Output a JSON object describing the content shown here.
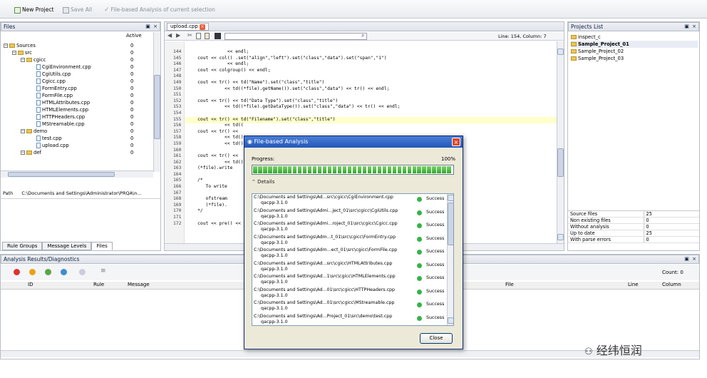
{
  "toolbar": {
    "new_project": "New Project",
    "save_all": "Save All",
    "file_based": "File-based Analysis of current selection"
  },
  "files_panel": {
    "title": "Files",
    "controls": "▣ ×",
    "col_active": "Active",
    "tree": [
      {
        "label": "Sources",
        "value": "0",
        "depth": 0,
        "type": "folder",
        "exp": "−"
      },
      {
        "label": "src",
        "value": "0",
        "depth": 1,
        "type": "folder",
        "exp": "−"
      },
      {
        "label": "cgicc",
        "value": "0",
        "depth": 2,
        "type": "folder",
        "exp": "−"
      },
      {
        "label": "CgiEnvironment.cpp",
        "value": "0",
        "depth": 3,
        "type": "file"
      },
      {
        "label": "CgiUtils.cpp",
        "value": "0",
        "depth": 3,
        "type": "file"
      },
      {
        "label": "Cgicc.cpp",
        "value": "0",
        "depth": 3,
        "type": "file"
      },
      {
        "label": "FormEntry.cpp",
        "value": "0",
        "depth": 3,
        "type": "file"
      },
      {
        "label": "FormFile.cpp",
        "value": "0",
        "depth": 3,
        "type": "file"
      },
      {
        "label": "HTMLAttributes.cpp",
        "value": "0",
        "depth": 3,
        "type": "file"
      },
      {
        "label": "HTMLElements.cpp",
        "value": "0",
        "depth": 3,
        "type": "file"
      },
      {
        "label": "HTTPHeaders.cpp",
        "value": "0",
        "depth": 3,
        "type": "file"
      },
      {
        "label": "MStreamable.cpp",
        "value": "0",
        "depth": 3,
        "type": "file"
      },
      {
        "label": "demo",
        "value": "0",
        "depth": 2,
        "type": "folder",
        "exp": "−"
      },
      {
        "label": "test.cpp",
        "value": "0",
        "depth": 3,
        "type": "file"
      },
      {
        "label": "upload.cpp",
        "value": "0",
        "depth": 3,
        "type": "file"
      },
      {
        "label": "def",
        "value": "0",
        "depth": 2,
        "type": "folder",
        "exp": "−"
      }
    ],
    "path_label": "Path",
    "path_value": "C:\\Documents and Settings\\Administrator\\PRQA\\n...",
    "tabs": [
      "Rule Groups",
      "Message Levels",
      "Files"
    ]
  },
  "editor": {
    "tab": "upload.cpp",
    "status": "Line: 154, Column: 7",
    "lines": [
      {
        "n": "144",
        "t": "               << endl;"
      },
      {
        "n": "145",
        "t": "    cout << col() .set(\"align\",\"left\").set(\"class\",\"data\").set(\"span\",\"1\")"
      },
      {
        "n": "146",
        "t": "               << endl;"
      },
      {
        "n": "147",
        "t": "    cout << colgroup() << endl;"
      },
      {
        "n": "148",
        "t": ""
      },
      {
        "n": "149",
        "t": "    cout << tr() << td(\"Name\").set(\"class\",\"title\")"
      },
      {
        "n": "150",
        "t": "              << td((*file).getName()).set(\"class\",\"data\") << tr() << endl;"
      },
      {
        "n": "151",
        "t": ""
      },
      {
        "n": "152",
        "t": "    cout << tr() << td(\"Data Type\").set(\"class\",\"title\")"
      },
      {
        "n": "153",
        "t": "              << td((*file).getDataType()).set(\"class\",\"data\") << tr() << endl;"
      },
      {
        "n": "154",
        "t": ""
      },
      {
        "n": "155",
        "t": "    cout << tr() << td(\"Filename\").set(\"class\",\"title\")"
      },
      {
        "n": "156",
        "t": "              << td(("
      },
      {
        "n": "157",
        "t": "    cout << tr() <<"
      },
      {
        "n": "158",
        "t": "              << td()"
      },
      {
        "n": "159",
        "t": "              << td()"
      },
      {
        "n": "160",
        "t": ""
      },
      {
        "n": "161",
        "t": "    cout << tr() <<"
      },
      {
        "n": "162",
        "t": "              << td()"
      },
      {
        "n": "163",
        "t": "    (*file).write"
      },
      {
        "n": "164",
        "t": ""
      },
      {
        "n": "165",
        "t": "    /*"
      },
      {
        "n": "166",
        "t": "       To write"
      },
      {
        "n": "167",
        "t": ""
      },
      {
        "n": "168",
        "t": "       ofstream"
      },
      {
        "n": "169",
        "t": "       (*file)."
      },
      {
        "n": "170",
        "t": "    */"
      },
      {
        "n": "171",
        "t": ""
      },
      {
        "n": "172",
        "t": "    cout << pre() <<"
      }
    ]
  },
  "dialog": {
    "title": "File-based Analysis",
    "progress_label": "Progress:",
    "progress_value": "100%",
    "progress_fraction": 1.0,
    "details": "Details",
    "close": "Close",
    "rows": [
      {
        "path": "C:\\Documents and Settings\\Ad...src\\cgicc\\CgiEnvironment.cpp",
        "tool": "qacpp-3.1.0",
        "status": "Success"
      },
      {
        "path": "C:\\Documents and Settings\\Admi...ject_01\\src\\cgicc\\CgiUtils.cpp",
        "tool": "qacpp-3.1.0",
        "status": "Success"
      },
      {
        "path": "C:\\Documents and Settings\\Admi...roject_01\\src\\cgicc\\Cgicc.cpp",
        "tool": "qacpp-3.1.0",
        "status": "Success"
      },
      {
        "path": "C:\\Documents and Settings\\Adm...t_01\\src\\cgicc\\FormEntry.cpp",
        "tool": "qacpp-3.1.0",
        "status": "Success"
      },
      {
        "path": "C:\\Documents and Settings\\Adm...ect_01\\src\\cgicc\\FormFile.cpp",
        "tool": "qacpp-3.1.0",
        "status": "Success"
      },
      {
        "path": "C:\\Documents and Settings\\Ad...src\\cgicc\\HTMLAttributes.cpp",
        "tool": "qacpp-3.1.0",
        "status": "Success"
      },
      {
        "path": "C:\\Documents and Settings\\Ad...1\\src\\cgicc\\HTMLElements.cpp",
        "tool": "qacpp-3.1.0",
        "status": "Success"
      },
      {
        "path": "C:\\Documents and Settings\\Ad...01\\src\\cgicc\\HTTPHeaders.cpp",
        "tool": "qacpp-3.1.0",
        "status": "Success"
      },
      {
        "path": "C:\\Documents and Settings\\Ad...01\\src\\cgicc\\MStreamable.cpp",
        "tool": "qacpp-3.1.0",
        "status": "Success"
      },
      {
        "path": "C:\\Documents and Settings\\Ad...Project_01\\src\\demo\\test.cpp",
        "tool": "qacpp-3.1.0",
        "status": "Success"
      }
    ]
  },
  "projects": {
    "title": "Projects List",
    "controls": "▣ ×",
    "items": [
      {
        "label": "inspect_c",
        "bold": false
      },
      {
        "label": "Sample_Project_01",
        "bold": true
      },
      {
        "label": "Sample_Project_02",
        "bold": false
      },
      {
        "label": "Sample_Project_03",
        "bold": false
      }
    ],
    "stats": [
      {
        "k": "Source files",
        "v": "25"
      },
      {
        "k": "Non existing files",
        "v": "0"
      },
      {
        "k": "Without analysis",
        "v": "0"
      },
      {
        "k": "Up to date",
        "v": "25"
      },
      {
        "k": "With parse errors",
        "v": "0"
      }
    ]
  },
  "results": {
    "title": "Analysis Results/Diagnostics",
    "controls": "▣ ×",
    "count": "Count: 0",
    "columns": {
      "id": "ID",
      "rule": "Rule",
      "message": "Message",
      "file": "File",
      "line": "Line",
      "column": "Column"
    }
  },
  "watermark": "经纬恒润"
}
